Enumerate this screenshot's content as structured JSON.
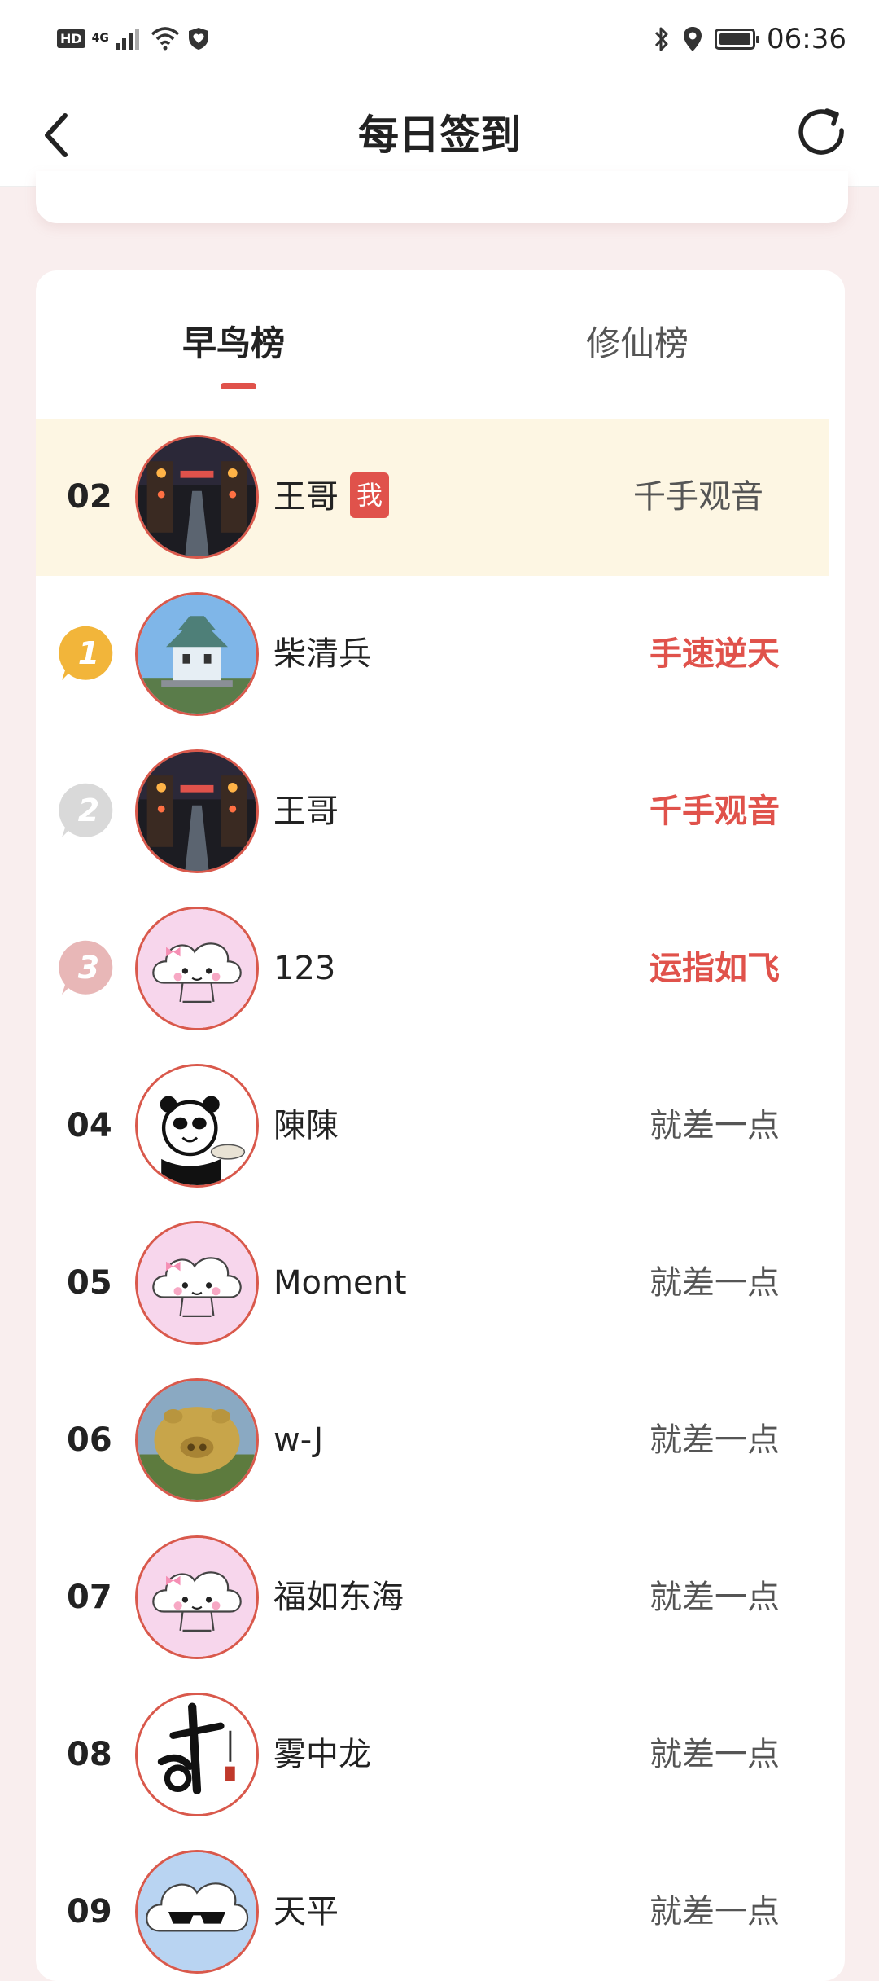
{
  "status_bar": {
    "hd": "HD",
    "network": "4G",
    "time": "06:36",
    "battery_level": 0.9
  },
  "header": {
    "title": "每日签到"
  },
  "tabs": [
    {
      "label": "早鸟榜",
      "active": true
    },
    {
      "label": "修仙榜",
      "active": false
    }
  ],
  "me_row": {
    "rank": "02",
    "name": "王哥",
    "badge": "我",
    "title": "千手观音"
  },
  "ranking": [
    {
      "rank": "1",
      "name": "柴清兵",
      "title": "手速逆天",
      "medal": "gold",
      "avatar": "castle"
    },
    {
      "rank": "2",
      "name": "王哥",
      "title": "千手观音",
      "medal": "silver",
      "avatar": "street"
    },
    {
      "rank": "3",
      "name": "123",
      "title": "运指如飞",
      "medal": "bronze",
      "avatar": "cloud"
    },
    {
      "rank": "04",
      "name": "陳陳",
      "title": "就差一点",
      "avatar": "panda"
    },
    {
      "rank": "05",
      "name": "Moment",
      "title": "就差一点",
      "avatar": "cloud"
    },
    {
      "rank": "06",
      "name": "w-J",
      "title": "就差一点",
      "avatar": "pig"
    },
    {
      "rank": "07",
      "name": "福如东海",
      "title": "就差一点",
      "avatar": "cloud"
    },
    {
      "rank": "08",
      "name": "雾中龙",
      "title": "就差一点",
      "avatar": "calligraphy"
    },
    {
      "rank": "09",
      "name": "天平",
      "title": "就差一点",
      "avatar": "cloud-sunglasses"
    }
  ],
  "colors": {
    "accent": "#e0524b",
    "me_row_bg": "#fdf6e3",
    "page_bg": "#f9eeee",
    "gold": "#f2b53a",
    "silver": "#d9d9d9",
    "bronze": "#e8b7b7"
  }
}
